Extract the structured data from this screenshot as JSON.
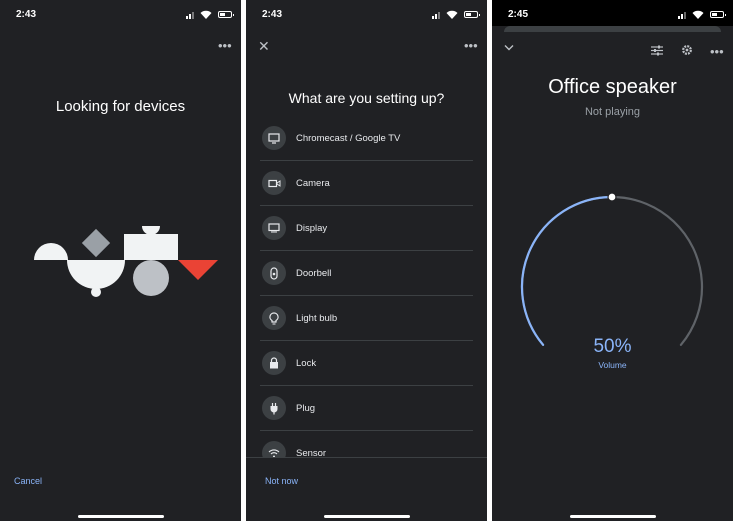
{
  "panels": {
    "searching": {
      "status_time": "2:43",
      "title": "Looking for devices",
      "cancel_label": "Cancel"
    },
    "setup": {
      "status_time": "2:43",
      "title": "What are you setting up?",
      "devices": [
        {
          "label": "Chromecast / Google TV",
          "icon": "tv-icon"
        },
        {
          "label": "Camera",
          "icon": "camera-icon"
        },
        {
          "label": "Display",
          "icon": "display-icon"
        },
        {
          "label": "Doorbell",
          "icon": "doorbell-icon"
        },
        {
          "label": "Light bulb",
          "icon": "lightbulb-icon"
        },
        {
          "label": "Lock",
          "icon": "lock-icon"
        },
        {
          "label": "Plug",
          "icon": "plug-icon"
        },
        {
          "label": "Sensor",
          "icon": "sensor-icon"
        }
      ],
      "not_now_label": "Not now"
    },
    "speaker": {
      "status_time": "2:45",
      "title": "Office speaker",
      "subtitle": "Not playing",
      "volume_value": "50%",
      "volume_fraction": 0.5,
      "volume_label": "Volume"
    }
  },
  "colors": {
    "background": "#202124",
    "accent": "#8ab4f8",
    "illustration_red": "#ea4335",
    "divider": "#3c4043"
  }
}
